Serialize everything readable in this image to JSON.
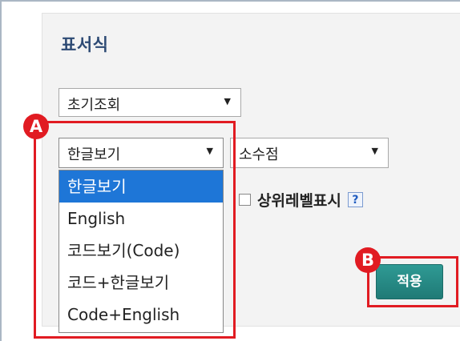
{
  "panel": {
    "title": "표서식"
  },
  "selects": {
    "initial": {
      "value": "초기조회"
    },
    "language": {
      "value": "한글보기"
    },
    "decimal": {
      "value": "소수점"
    }
  },
  "dropdown": {
    "options": [
      "한글보기",
      "English",
      "코드보기(Code)",
      "코드+한글보기",
      "Code+English"
    ],
    "selected_index": 0
  },
  "checkbox": {
    "label": "상위레벨표시",
    "checked": false,
    "help_label": "?"
  },
  "apply_button": {
    "label": "적용"
  },
  "markers": {
    "a": "A",
    "b": "B"
  },
  "colors": {
    "title": "#2d4a74",
    "selected_option": "#1e76d7",
    "button": "#1f7a76",
    "marker": "#e11b22"
  }
}
